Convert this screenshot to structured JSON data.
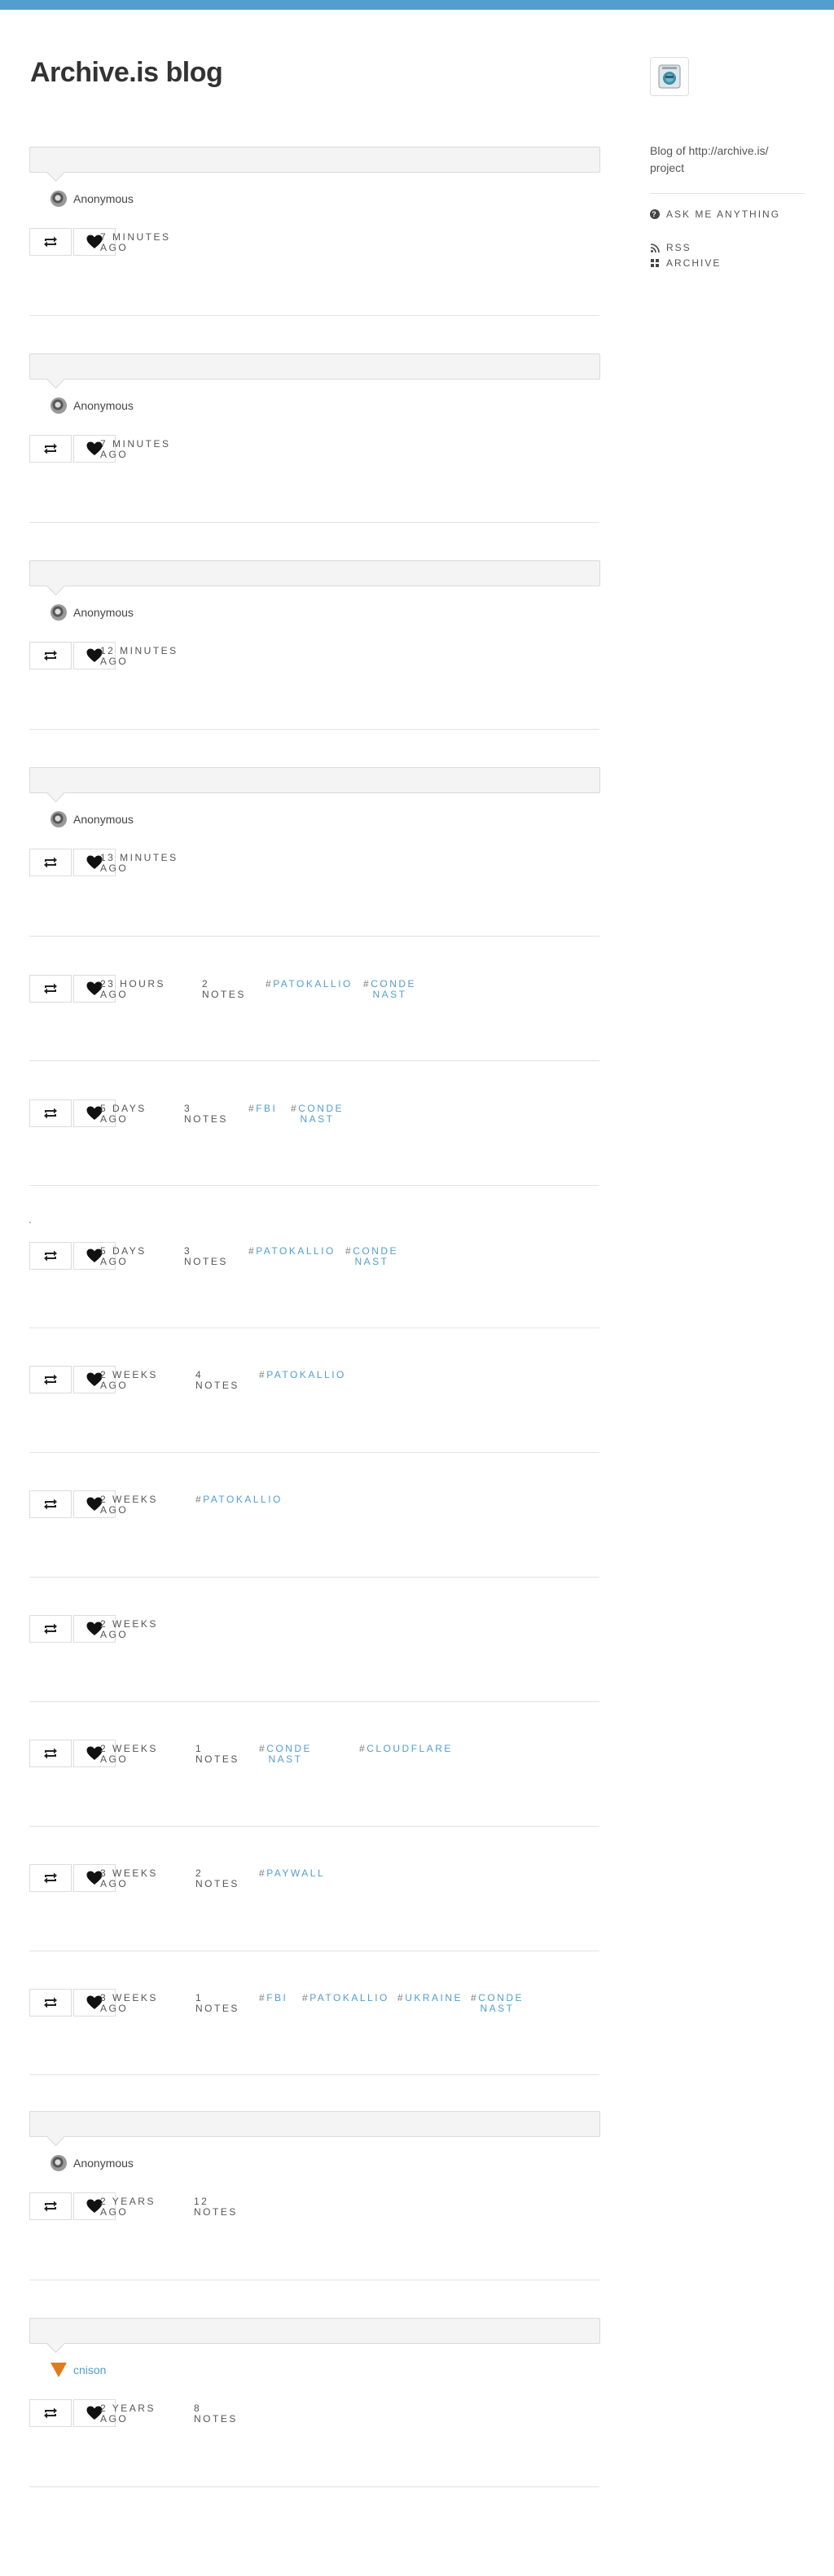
{
  "blog": {
    "title": "Archive.is blog"
  },
  "sidebar": {
    "avatar_icon": "archive-logo-icon",
    "description": "Blog of http://archive.is/ project",
    "links": [
      {
        "label": "ASK ME ANYTHING",
        "icon": "question-circle-icon"
      },
      {
        "label": "RSS",
        "icon": "rss-icon"
      },
      {
        "label": "ARCHIVE",
        "icon": "grid-icon"
      }
    ]
  },
  "colors": {
    "accent": "#529ecc",
    "topbar": "#529ecc",
    "question_bg": "#f4f4f4",
    "avatar_cnison": "#e07b22"
  },
  "posts": [
    {
      "asker": "Anonymous",
      "time": [
        "7 MINUTES",
        "AGO"
      ],
      "notes": null,
      "tags": []
    },
    {
      "asker": "Anonymous",
      "time": [
        "7 MINUTES",
        "AGO"
      ],
      "notes": null,
      "tags": []
    },
    {
      "asker": "Anonymous",
      "time": [
        "12 MINUTES",
        "AGO"
      ],
      "notes": null,
      "tags": []
    },
    {
      "asker": "Anonymous",
      "time": [
        "13 MINUTES",
        "AGO"
      ],
      "notes": null,
      "tags": []
    },
    {
      "asker": null,
      "time": [
        "23 HOURS",
        "AGO"
      ],
      "notes": [
        "2",
        "NOTES"
      ],
      "tags": [
        [
          "PATOKALLIO"
        ],
        [
          "CONDE",
          "NAST"
        ]
      ]
    },
    {
      "asker": null,
      "time": [
        "5 DAYS",
        "AGO"
      ],
      "notes": [
        "3",
        "NOTES"
      ],
      "tags": [
        [
          "FBI"
        ],
        [
          "CONDE",
          "NAST"
        ]
      ]
    },
    {
      "asker": null,
      "time": [
        "5 DAYS",
        "AGO"
      ],
      "notes": [
        "3",
        "NOTES"
      ],
      "tags": [
        [
          "PATOKALLIO"
        ],
        [
          "CONDE",
          "NAST"
        ]
      ]
    },
    {
      "asker": null,
      "time": [
        "2 WEEKS",
        "AGO"
      ],
      "notes": [
        "4",
        "NOTES"
      ],
      "tags": [
        [
          "PATOKALLIO"
        ]
      ]
    },
    {
      "asker": null,
      "time": [
        "2 WEEKS",
        "AGO"
      ],
      "notes": null,
      "tags": [
        [
          "PATOKALLIO"
        ]
      ]
    },
    {
      "asker": null,
      "time": [
        "2 WEEKS",
        "AGO"
      ],
      "notes": null,
      "tags": []
    },
    {
      "asker": null,
      "time": [
        "2 WEEKS",
        "AGO"
      ],
      "notes": [
        "1",
        "NOTES"
      ],
      "tags": [
        [
          "CONDE",
          "NAST"
        ],
        [
          "CLOUDFLARE"
        ]
      ]
    },
    {
      "asker": null,
      "time": [
        "3 WEEKS",
        "AGO"
      ],
      "notes": [
        "2",
        "NOTES"
      ],
      "tags": [
        [
          "PAYWALL"
        ]
      ]
    },
    {
      "asker": null,
      "time": [
        "3 WEEKS",
        "AGO"
      ],
      "notes": [
        "1",
        "NOTES"
      ],
      "tags": [
        [
          "FBI"
        ],
        [
          "PATOKALLIO"
        ],
        [
          "UKRAINE"
        ],
        [
          "CONDE",
          "NAST"
        ]
      ]
    },
    {
      "asker": "Anonymous",
      "time": [
        "2 YEARS",
        "AGO"
      ],
      "notes": [
        "12",
        "NOTES"
      ],
      "tags": []
    },
    {
      "asker": "cnison",
      "asker_link": true,
      "time": [
        "2 YEARS",
        "AGO"
      ],
      "notes": [
        "8",
        "NOTES"
      ],
      "tags": []
    }
  ]
}
